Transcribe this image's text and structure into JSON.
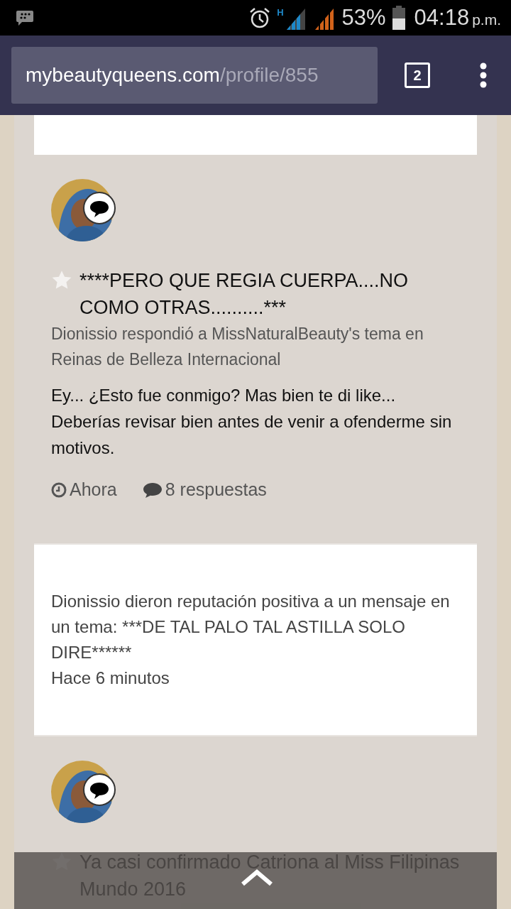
{
  "status_bar": {
    "network_type": "H",
    "battery": "53%",
    "time": "04:18",
    "period": "p.m."
  },
  "browser": {
    "url_host": "mybeautyqueens.com",
    "url_path": "/profile/855",
    "tab_count": "2"
  },
  "feed": [
    {
      "kind": "blank"
    },
    {
      "kind": "post",
      "title": "****PERO QUE REGIA CUERPA....NO COMO OTRAS..........***",
      "meta": "Dionissio respondió a MissNaturalBeauty's tema en Reinas de Belleza Internacional",
      "body": "Ey... ¿Esto fue conmigo? Mas bien te di like... Deberías revisar bien antes de venir a ofenderme sin motivos.",
      "time": "Ahora",
      "replies": "8 respuestas"
    },
    {
      "kind": "notice",
      "text": "Dionissio dieron reputación positiva a un mensaje en un tema: ***DE TAL PALO TAL ASTILLA SOLO DIRE******",
      "time": "Hace 6 minutos"
    },
    {
      "kind": "post",
      "title": "Ya casi confirmado Catriona al Miss Filipinas Mundo 2016"
    }
  ]
}
